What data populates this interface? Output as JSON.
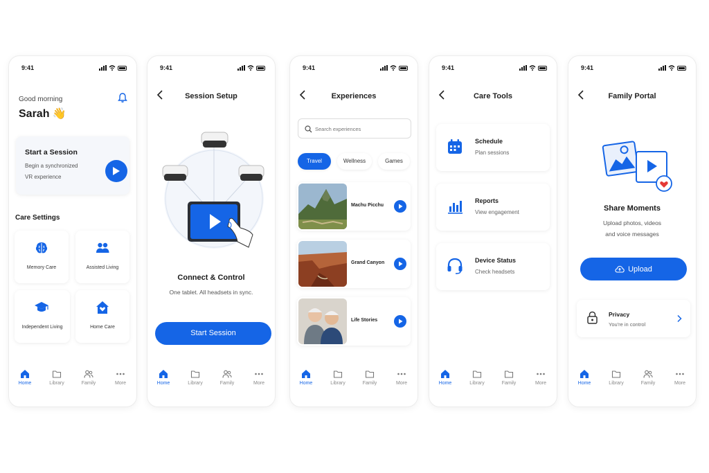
{
  "status_time": "9:41",
  "tabbar": {
    "home": "Home",
    "library": "Library",
    "family": "Family",
    "more": "More"
  },
  "screen1": {
    "greeting": "Good morning",
    "name": "Sarah 👋",
    "session_card": {
      "title": "Start a Session",
      "line1": "Begin a synchronized",
      "line2": "VR experience"
    },
    "section_title": "Care Settings",
    "tiles": [
      "Memory Care",
      "Assisted Living",
      "Independent Living",
      "Home Care"
    ]
  },
  "screen2": {
    "title": "Session Setup",
    "heading": "Connect & Control",
    "subtext": "One tablet. All headsets in sync.",
    "button": "Start Session"
  },
  "screen3": {
    "title": "Experiences",
    "search_placeholder": "Search experiences",
    "chips": [
      "Travel",
      "Wellness",
      "Games"
    ],
    "items": [
      "Machu Picchu",
      "Grand Canyon",
      "Life Stories"
    ]
  },
  "screen4": {
    "title": "Care Tools",
    "tools": [
      {
        "title": "Schedule",
        "subtitle": "Plan sessions"
      },
      {
        "title": "Reports",
        "subtitle": "View engagement"
      },
      {
        "title": "Device Status",
        "subtitle": "Check headsets"
      }
    ]
  },
  "screen5": {
    "title": "Family Portal",
    "heading": "Share Moments",
    "line1": "Upload photos, videos",
    "line2": "and voice messages",
    "button": "Upload",
    "privacy_title": "Privacy",
    "privacy_sub": "You're in control"
  },
  "colors": {
    "accent": "#1565e6",
    "background": "#ffffff",
    "text": "#1a1a1a"
  }
}
